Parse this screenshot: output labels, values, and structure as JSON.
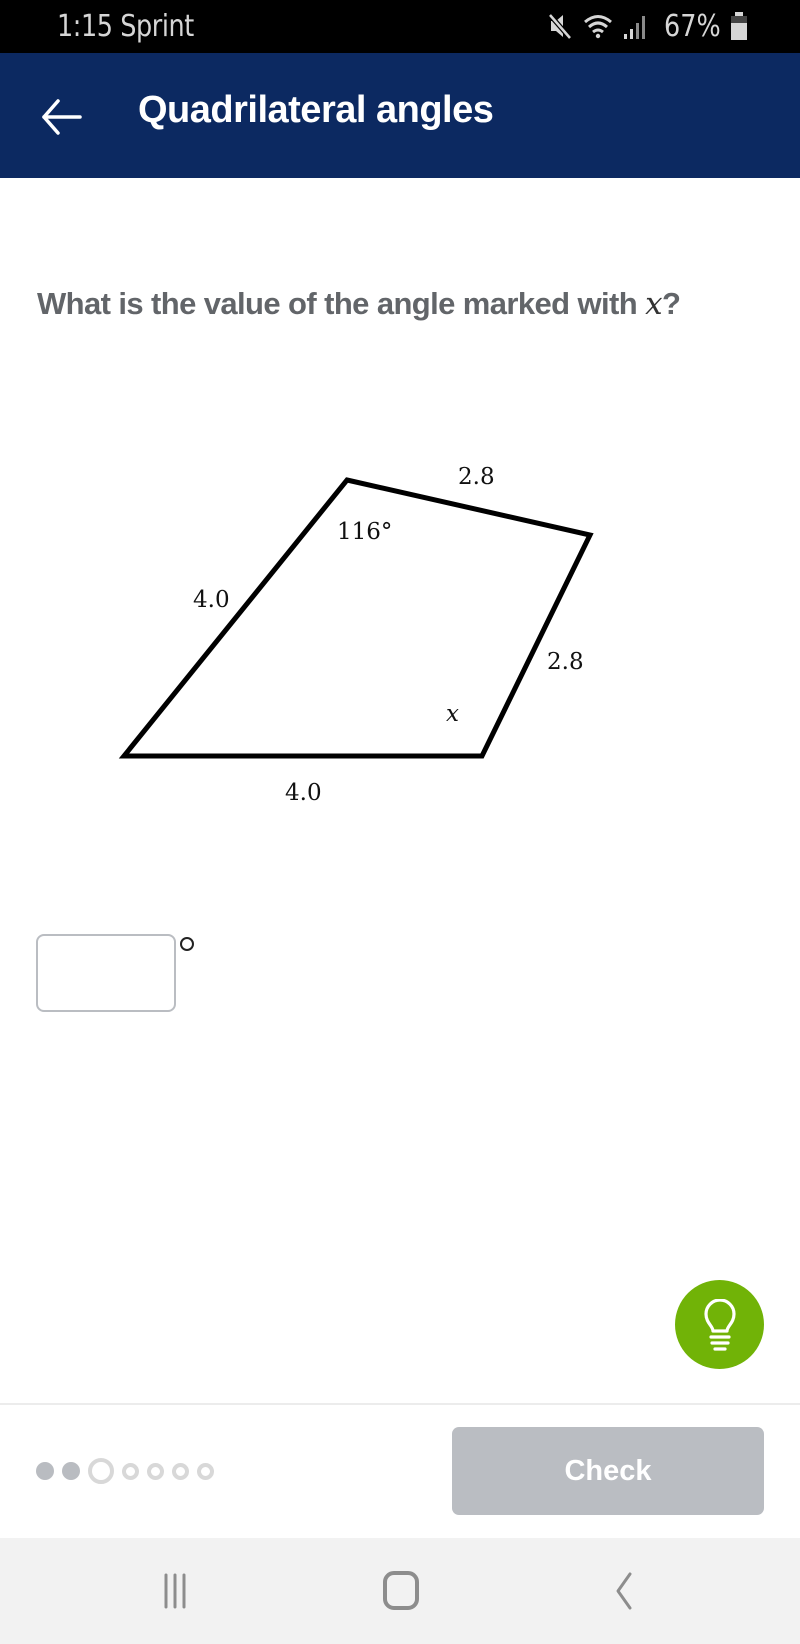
{
  "status_bar": {
    "time_carrier": "1:15 Sprint",
    "battery_percent": "67%",
    "icons": [
      "mute-icon",
      "wifi-icon",
      "signal-icon",
      "battery-icon"
    ]
  },
  "header": {
    "back_icon": "arrow-left-icon",
    "title": "Quadrilateral angles",
    "background_color": "#0c2961"
  },
  "question": {
    "text": "What is the value of the angle marked with ",
    "variable": "x",
    "suffix": "?"
  },
  "diagram": {
    "shape": "quadrilateral",
    "labels": {
      "top_side": "2.8",
      "left_side": "4.0",
      "right_side": "2.8",
      "bottom_side": "4.0",
      "top_angle": "116°",
      "unknown_angle": "x"
    }
  },
  "answer": {
    "value": "",
    "placeholder": "",
    "unit_symbol": "°"
  },
  "hint": {
    "icon": "lightbulb-icon",
    "color": "#71b307"
  },
  "progress": {
    "total": 7,
    "completed": 2,
    "current_index": 3
  },
  "footer": {
    "check_label": "Check",
    "check_enabled": false
  },
  "nav_bar": {
    "items": [
      "recent-apps-icon",
      "home-icon",
      "back-icon"
    ]
  }
}
